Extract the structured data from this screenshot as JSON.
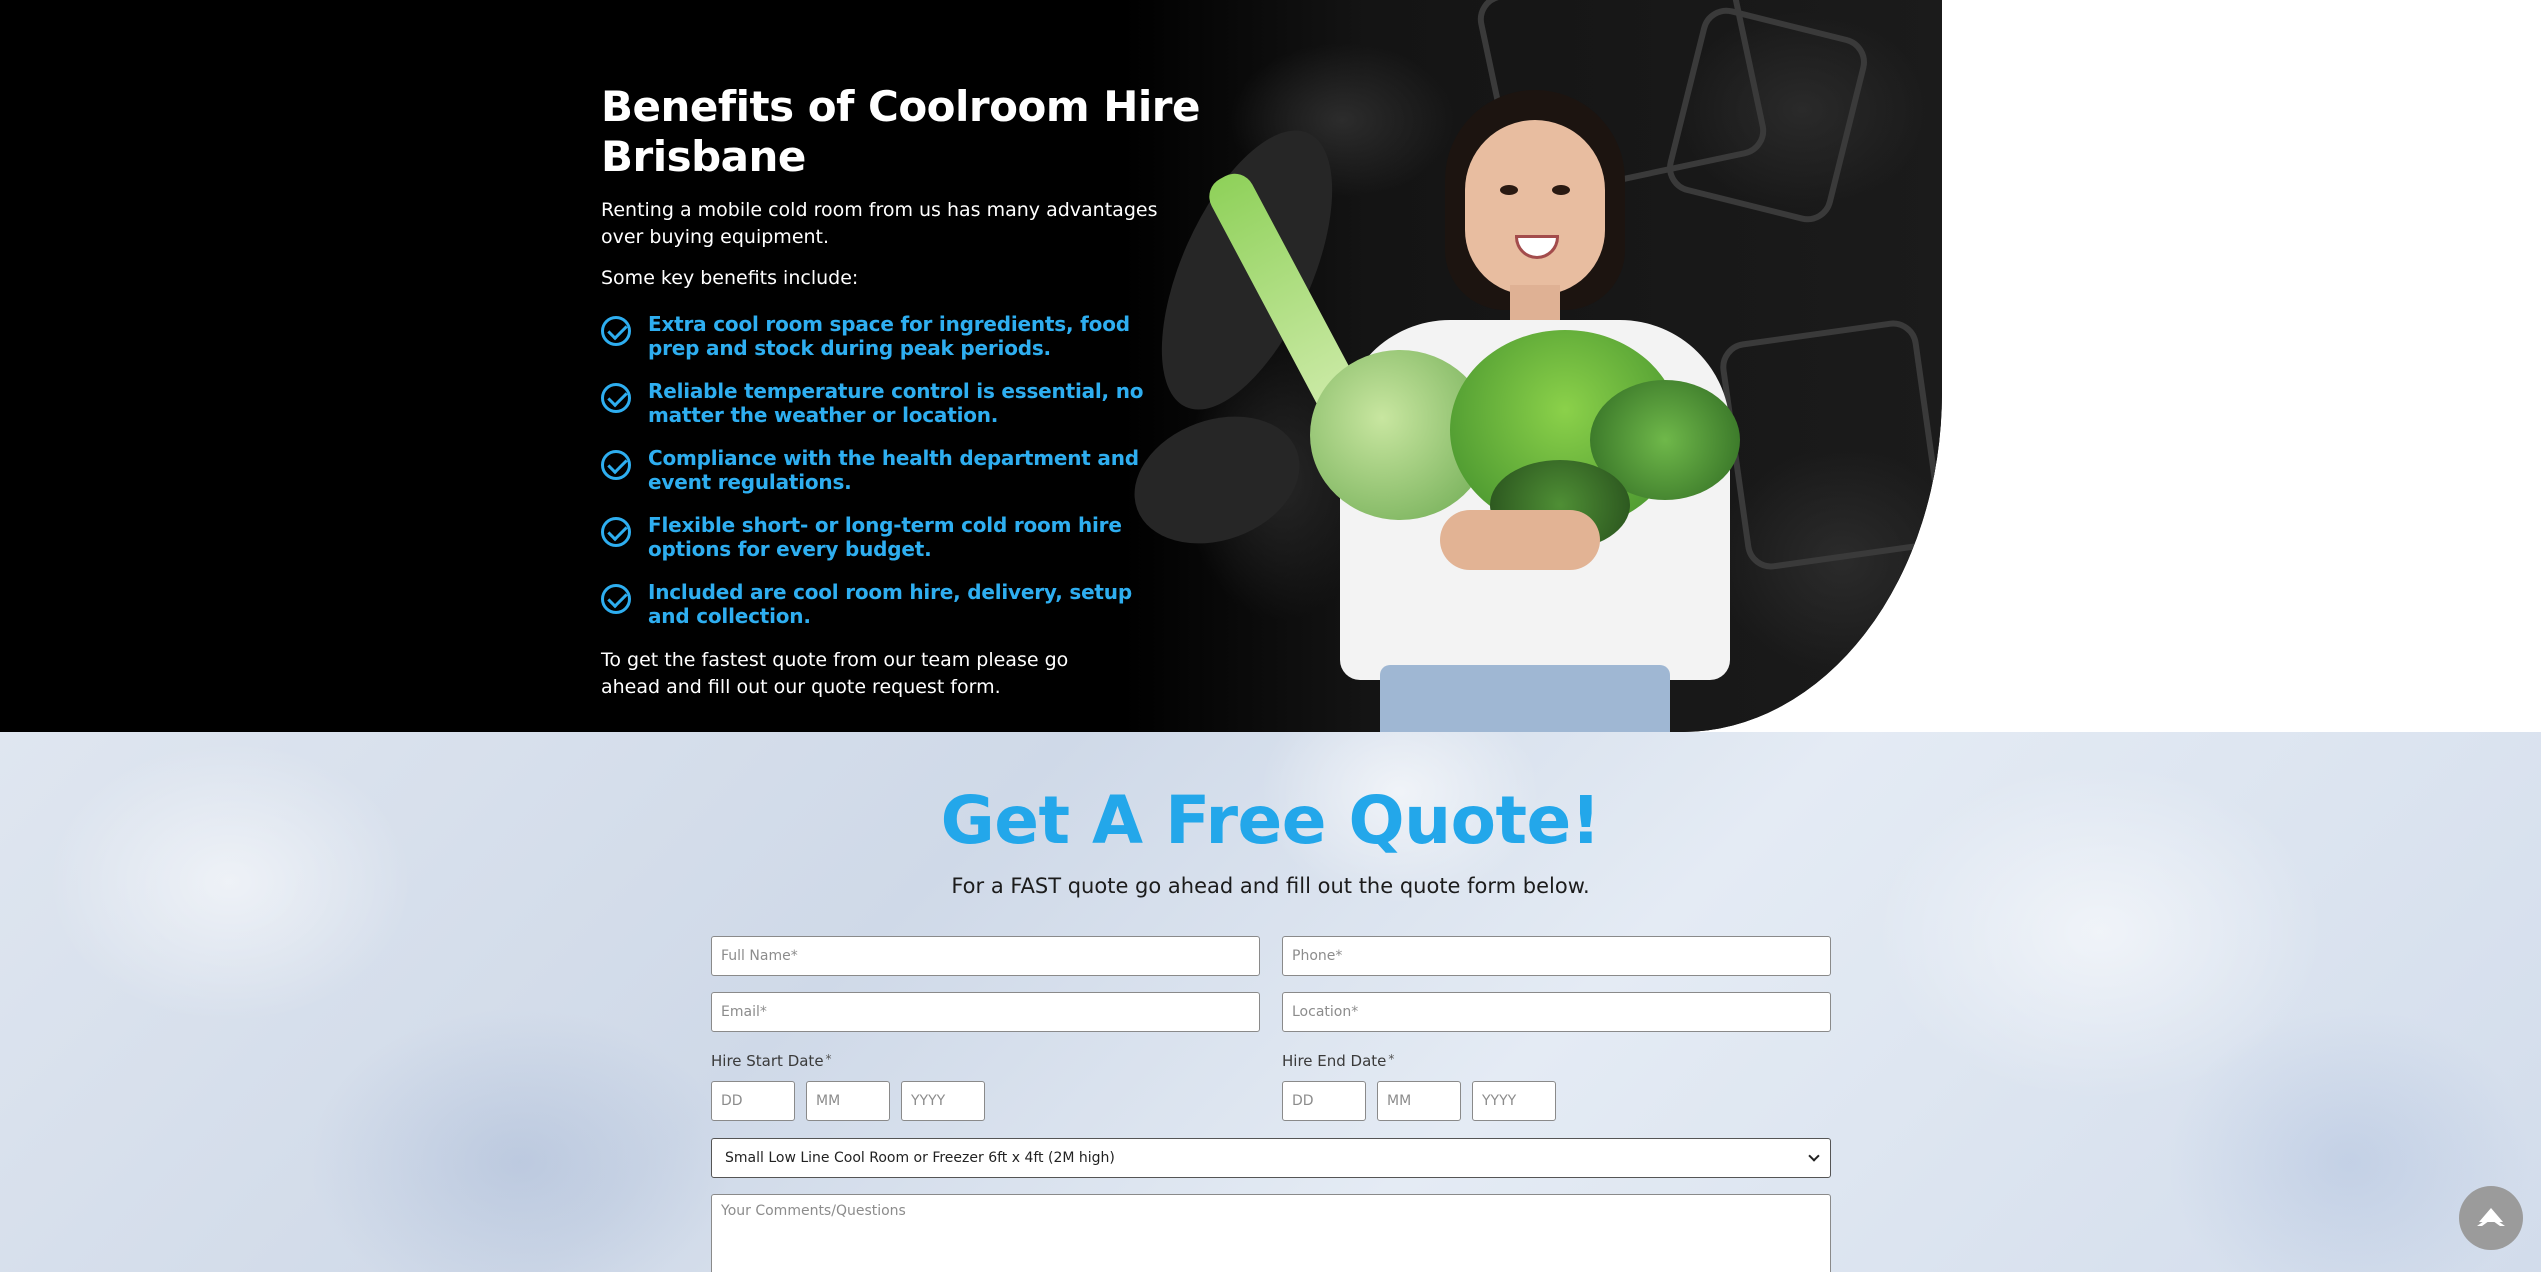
{
  "benefits_section": {
    "title": "Benefits of Coolroom Hire Brisbane",
    "intro": "Renting a mobile cold room from us has many advantages over buying equipment.",
    "lead": "Some key benefits include:",
    "items": [
      "Extra cool room space for ingredients, food prep and stock during peak periods.",
      "Reliable temperature control is essential, no matter the weather or location.",
      "Compliance with the health department and event regulations.",
      "Flexible short- or long-term cold room hire options for every budget.",
      "Included are cool room hire, delivery, setup and collection."
    ],
    "cta": "To get the fastest quote from our team please go ahead and fill out our quote request form.",
    "accent_color": "#2eaef0",
    "background_color": "#000000"
  },
  "quote_section": {
    "title": "Get A Free Quote!",
    "subtitle": "For a FAST quote go ahead and fill out the quote form below.",
    "title_color": "#23a7ea",
    "form": {
      "full_name_placeholder": "Full Name*",
      "phone_placeholder": "Phone*",
      "email_placeholder": "Email*",
      "location_placeholder": "Location*",
      "hire_start_label": "Hire Start Date",
      "hire_end_label": "Hire End Date",
      "required_marker": "*",
      "day_placeholder": "DD",
      "month_placeholder": "MM",
      "year_placeholder": "YYYY",
      "room_select_value": "Small Low Line Cool Room or Freezer 6ft x 4ft (2M high)",
      "comments_placeholder": "Your Comments/Questions"
    }
  },
  "scroll_top": {
    "icon": "chevron-up-icon"
  }
}
